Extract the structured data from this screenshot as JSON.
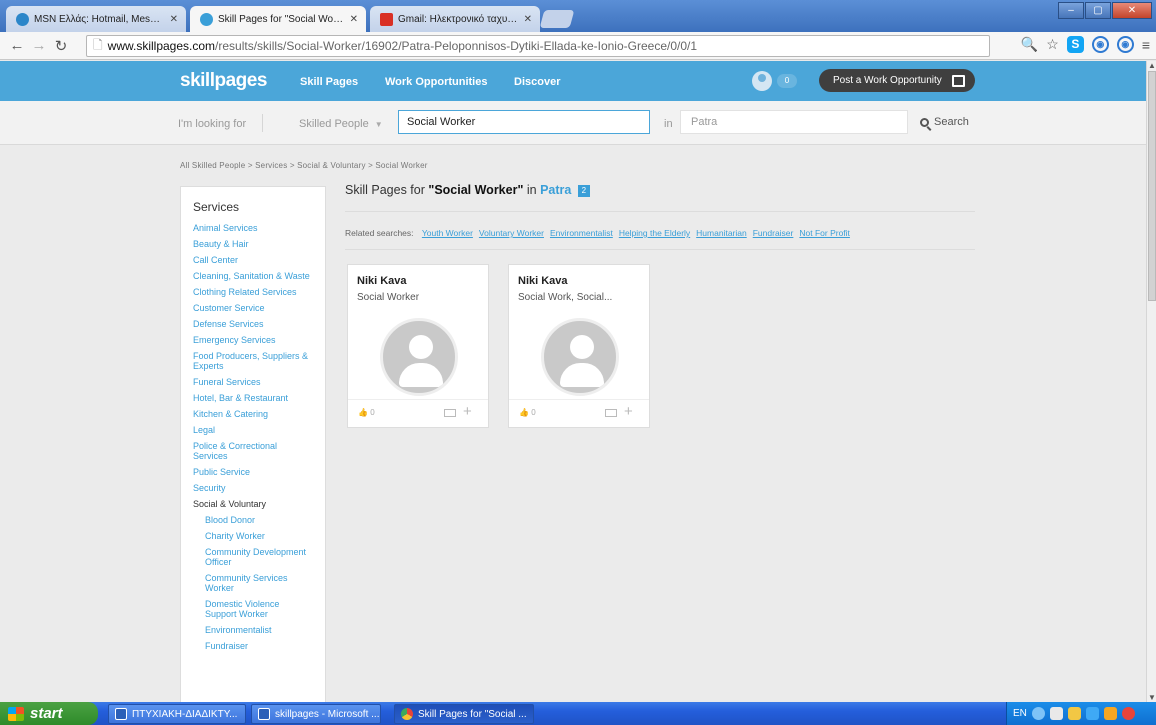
{
  "browser": {
    "tabs": [
      {
        "title": "MSN Ελλάς: Hotmail, Messen",
        "active": false,
        "favicon_color": "#2b86c9"
      },
      {
        "title": "Skill Pages for \"Social Worker",
        "active": true,
        "favicon_color": "#3a9fd8"
      },
      {
        "title": "Gmail: Ηλεκτρονικό ταχυδρο",
        "active": false,
        "favicon_color": "#d93025"
      }
    ],
    "url_domain": "www.skillpages.com",
    "url_path": "/results/skills/Social-Worker/16902/Patra-Peloponnisos-Dytiki-Ellada-ke-Ionio-Greece/0/0/1",
    "window_buttons": [
      "–",
      "▢",
      "✕"
    ]
  },
  "site": {
    "logo": "skillpages",
    "nav": [
      "Skill Pages",
      "Work Opportunities",
      "Discover"
    ],
    "notifications": "0",
    "post_button": "Post a Work Opportunity"
  },
  "search": {
    "looking_for": "I'm looking for",
    "category": "Skilled People",
    "query": "Social Worker",
    "in_label": "in",
    "location": "Patra",
    "button": "Search"
  },
  "breadcrumb": "All Skilled People > Services > Social & Voluntary > Social Worker",
  "sidebar": {
    "title": "Services",
    "items": [
      {
        "label": "Animal Services",
        "type": "link"
      },
      {
        "label": "Beauty & Hair",
        "type": "link"
      },
      {
        "label": "Call Center",
        "type": "link"
      },
      {
        "label": "Cleaning, Sanitation & Waste",
        "type": "link"
      },
      {
        "label": "Clothing Related Services",
        "type": "link"
      },
      {
        "label": "Customer Service",
        "type": "link"
      },
      {
        "label": "Defense Services",
        "type": "link"
      },
      {
        "label": "Emergency Services",
        "type": "link"
      },
      {
        "label": "Food Producers, Suppliers & Experts",
        "type": "link"
      },
      {
        "label": "Funeral Services",
        "type": "link"
      },
      {
        "label": "Hotel, Bar & Restaurant",
        "type": "link"
      },
      {
        "label": "Kitchen & Catering",
        "type": "link"
      },
      {
        "label": "Legal",
        "type": "link"
      },
      {
        "label": "Police & Correctional Services",
        "type": "link"
      },
      {
        "label": "Public Service",
        "type": "link"
      },
      {
        "label": "Security",
        "type": "link"
      },
      {
        "label": "Social & Voluntary",
        "type": "current"
      },
      {
        "label": "Blood Donor",
        "type": "sub"
      },
      {
        "label": "Charity Worker",
        "type": "sub"
      },
      {
        "label": "Community Development Officer",
        "type": "sub"
      },
      {
        "label": "Community Services Worker",
        "type": "sub"
      },
      {
        "label": "Domestic Violence Support Worker",
        "type": "sub"
      },
      {
        "label": "Environmentalist",
        "type": "sub"
      },
      {
        "label": "Fundraiser",
        "type": "sub"
      }
    ]
  },
  "results": {
    "prefix": "Skill Pages for",
    "query": "\"Social Worker\"",
    "in": "in",
    "city": "Patra",
    "count": "2",
    "related_label": "Related searches:",
    "related": [
      "Youth Worker",
      "Voluntary Worker",
      "Environmentalist",
      "Helping the Elderly",
      "Humanitarian",
      "Fundraiser",
      "Not For Profit"
    ],
    "cards": [
      {
        "name": "Niki Kava",
        "role": "Social Worker",
        "likes": "0"
      },
      {
        "name": "Niki Kava",
        "role": "Social Work, Social...",
        "likes": "0"
      }
    ]
  },
  "taskbar": {
    "start": "start",
    "tasks": [
      {
        "label": "ΠΤΥΧΙΑΚΗ-ΔΙΑΔΙΚΤΥ...",
        "active": false
      },
      {
        "label": "skillpages - Microsoft ...",
        "active": false
      },
      {
        "label": "Skill Pages for \"Social ...",
        "active": true
      }
    ],
    "lang": "EN"
  },
  "colors": {
    "brand": "#4ba6d9",
    "link": "#3a9fd8",
    "post_button": "#3f3f3f"
  }
}
